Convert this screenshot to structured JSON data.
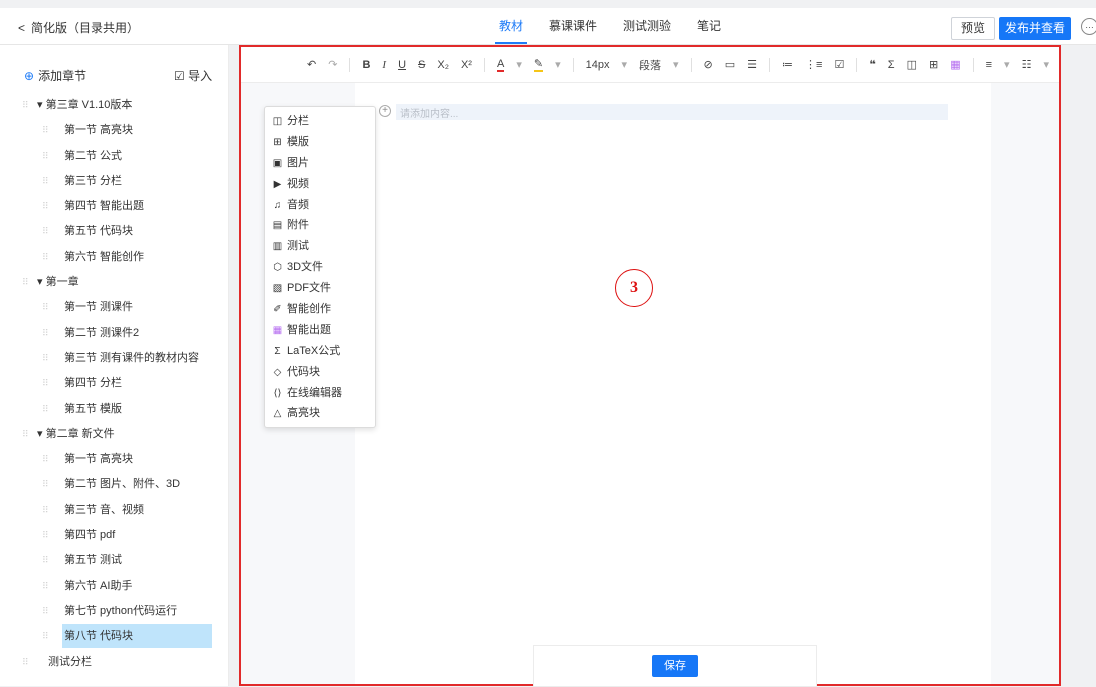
{
  "header": {
    "back_label": "简化版（目录共用）",
    "tabs": [
      {
        "label": "教材",
        "active": true
      },
      {
        "label": "慕课课件",
        "active": false
      },
      {
        "label": "测试测验",
        "active": false
      },
      {
        "label": "笔记",
        "active": false
      }
    ],
    "preview_label": "预览",
    "publish_label": "发布并查看",
    "more_icon": "…"
  },
  "sidebar": {
    "add_chapter_label": "添加章节",
    "import_label": "导入",
    "items": [
      {
        "type": "chapter",
        "label": "第三章 V1.10版本"
      },
      {
        "type": "section",
        "label": "第一节 高亮块"
      },
      {
        "type": "section",
        "label": "第二节 公式"
      },
      {
        "type": "section",
        "label": "第三节 分栏"
      },
      {
        "type": "section",
        "label": "第四节 智能出题"
      },
      {
        "type": "section",
        "label": "第五节 代码块"
      },
      {
        "type": "section",
        "label": "第六节 智能创作"
      },
      {
        "type": "chapter",
        "label": "第一章"
      },
      {
        "type": "section",
        "label": "第一节 测课件"
      },
      {
        "type": "section",
        "label": "第二节 测课件2"
      },
      {
        "type": "section",
        "label": "第三节 测有课件的教材内容"
      },
      {
        "type": "section",
        "label": "第四节 分栏"
      },
      {
        "type": "section",
        "label": "第五节 模版"
      },
      {
        "type": "chapter",
        "label": "第二章 新文件"
      },
      {
        "type": "section",
        "label": "第一节 高亮块"
      },
      {
        "type": "section",
        "label": "第二节 图片、附件、3D"
      },
      {
        "type": "section",
        "label": "第三节 音、视频"
      },
      {
        "type": "section",
        "label": "第四节 pdf"
      },
      {
        "type": "section",
        "label": "第五节 测试"
      },
      {
        "type": "section",
        "label": "第六节 AI助手"
      },
      {
        "type": "section",
        "label": "第七节 python代码运行"
      },
      {
        "type": "section",
        "label": "第八节 代码块",
        "selected": true
      },
      {
        "type": "plain",
        "label": "测试分栏"
      }
    ]
  },
  "toolbar": {
    "undo": "↶",
    "redo": "↷",
    "bold": "B",
    "italic": "I",
    "underline": "U",
    "strike": "S",
    "subscript": "X₂",
    "superscript": "X²",
    "font_color": "A",
    "highlight": "✎",
    "font_size": "14px",
    "paragraph": "段落",
    "dropdown_arrow": "▾"
  },
  "editor": {
    "placeholder": "请添加内容...",
    "annotation_number": "3",
    "save_label": "保存"
  },
  "insert_menu": [
    {
      "icon": "◫",
      "label": "分栏"
    },
    {
      "icon": "⊞",
      "label": "模版"
    },
    {
      "icon": "▣",
      "label": "图片"
    },
    {
      "icon": "▶",
      "label": "视频"
    },
    {
      "icon": "♫",
      "label": "音频"
    },
    {
      "icon": "▤",
      "label": "附件"
    },
    {
      "icon": "▥",
      "label": "测试"
    },
    {
      "icon": "⬡",
      "label": "3D文件"
    },
    {
      "icon": "▧",
      "label": "PDF文件"
    },
    {
      "icon": "✐",
      "label": "智能创作"
    },
    {
      "icon": "▦",
      "label": "智能出题",
      "accent": true
    },
    {
      "icon": "Σ",
      "label": "LaTeX公式"
    },
    {
      "icon": "◇",
      "label": "代码块"
    },
    {
      "icon": "⟨⟩",
      "label": "在线编辑器"
    },
    {
      "icon": "△",
      "label": "高亮块"
    }
  ],
  "colors": {
    "accent": "#1677f7",
    "selected_bg": "#bfe4fb",
    "annotation_red": "#e12a2a",
    "purple_icon": "#b56cf0"
  }
}
